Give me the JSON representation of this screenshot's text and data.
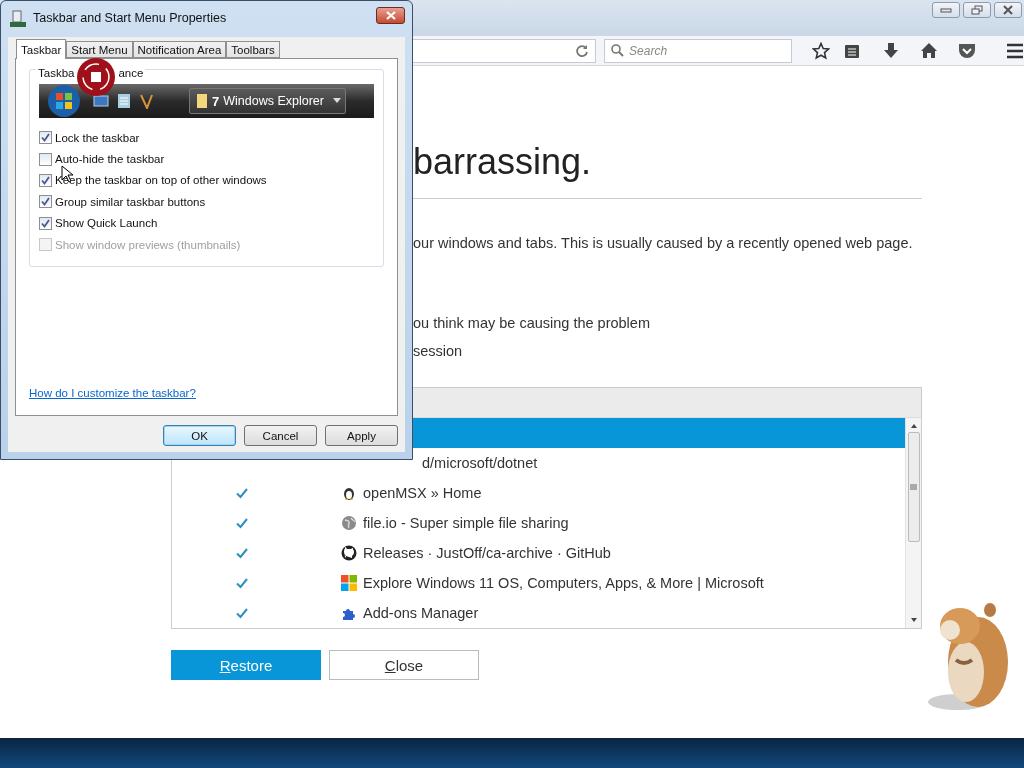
{
  "browser": {
    "search": {
      "placeholder": "Search"
    },
    "page": {
      "heading": "barrassing.",
      "description": "our windows and tabs. This is usually caused by a recently opened web page.",
      "steps": [
        "ou think may be causing the problem",
        "session"
      ],
      "restore_list": [
        {
          "selected": true
        },
        {
          "title": "d/microsoft/dotnet",
          "selected": false
        },
        {
          "title": "openMSX » Home",
          "checked": true,
          "selected": false
        },
        {
          "title": "file.io - Super simple file sharing",
          "checked": true,
          "selected": false
        },
        {
          "title": "Releases · JustOff/ca-archive · GitHub",
          "checked": true,
          "selected": false
        },
        {
          "title": "Explore Windows 11 OS, Computers, Apps, & More | Microsoft",
          "checked": true,
          "selected": false
        },
        {
          "title": "Add-ons Manager",
          "checked": true,
          "selected": false
        }
      ],
      "buttons": [
        {
          "label": "Restore",
          "primary": true
        },
        {
          "label": "Close",
          "primary": false
        }
      ]
    }
  },
  "dialog": {
    "title": "Taskbar and Start Menu Properties",
    "tabs": [
      {
        "label": "Taskbar",
        "selected": true
      },
      {
        "label": "Start Menu",
        "selected": false
      },
      {
        "label": "Notification Area",
        "selected": false
      },
      {
        "label": "Toolbars",
        "selected": false
      }
    ],
    "group_label_parts": [
      "Taskba",
      "ance"
    ],
    "preview": {
      "count": "7",
      "button": "Windows Explorer"
    },
    "options": [
      {
        "label": "Lock the taskbar",
        "checked": true,
        "disabled": false
      },
      {
        "label": "Auto-hide the taskbar",
        "checked": false,
        "disabled": false
      },
      {
        "label": "Keep the taskbar on top of other windows",
        "checked": true,
        "disabled": false
      },
      {
        "label": "Group similar taskbar buttons",
        "checked": true,
        "disabled": false
      },
      {
        "label": "Show Quick Launch",
        "checked": true,
        "disabled": false
      },
      {
        "label": "Show window previews (thumbnails)",
        "checked": false,
        "disabled": true
      }
    ],
    "help_link": "How do I customize the taskbar?",
    "buttons": [
      {
        "label": "OK",
        "default": true
      },
      {
        "label": "Cancel",
        "default": false
      },
      {
        "label": "Apply",
        "default": false
      }
    ]
  }
}
